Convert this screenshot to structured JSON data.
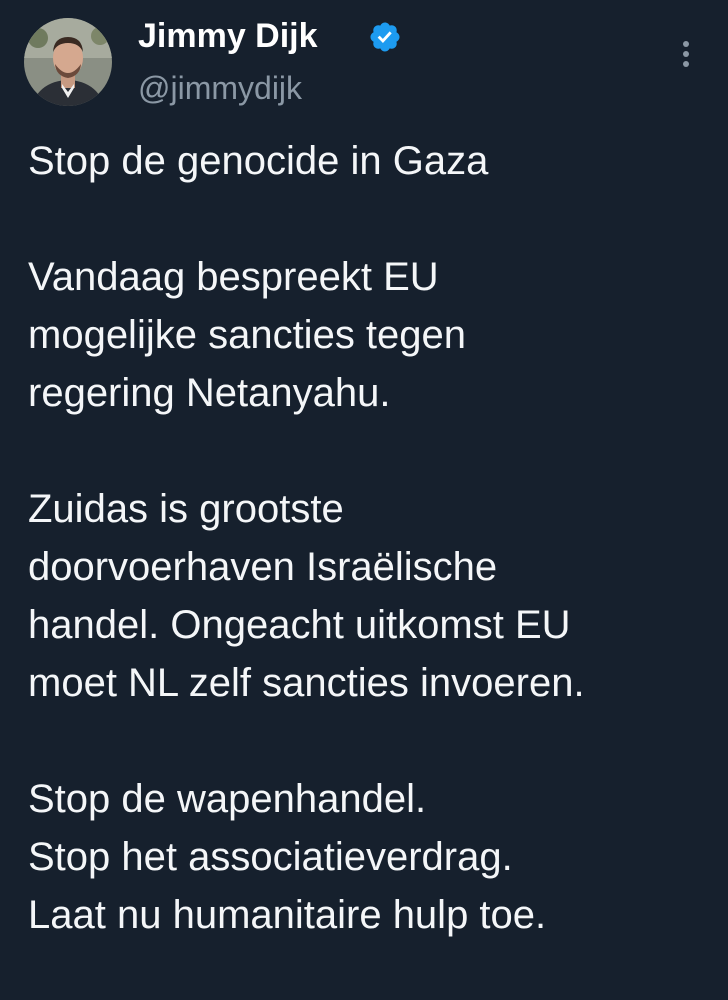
{
  "author": {
    "display_name": "Jimmy Dijk",
    "handle": "@jimmydijk",
    "verified": true,
    "verified_icon": "verified-badge-icon",
    "avatar_icon": "avatar",
    "more_icon": "more-options-icon"
  },
  "colors": {
    "background": "#16202d",
    "text": "#f4f6f8",
    "handle": "#8b98a5",
    "verified": "#1d9bf0"
  },
  "tweet": {
    "lines": [
      "Stop de genocide in Gaza",
      "",
      "Vandaag bespreekt EU",
      "mogelijke sancties tegen",
      "regering Netanyahu.",
      "",
      "Zuidas is grootste",
      "doorvoerhaven Israëlische",
      "handel. Ongeacht uitkomst EU",
      "moet NL zelf sancties invoeren.",
      "",
      "Stop de wapenhandel.",
      "Stop het associatieverdrag.",
      "Laat nu humanitaire hulp toe."
    ]
  }
}
